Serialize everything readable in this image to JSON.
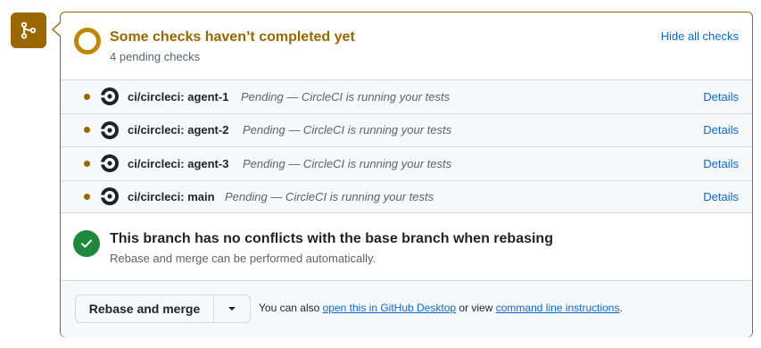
{
  "checks_summary": {
    "title": "Some checks haven’t completed yet",
    "subtitle": "4 pending checks",
    "hide_label": "Hide all checks"
  },
  "checks": [
    {
      "name": "ci/circleci: agent-1",
      "description": "Pending — CircleCI is running your tests",
      "details_label": "Details"
    },
    {
      "name": "ci/circleci: agent-2",
      "description": "Pending — CircleCI is running your tests",
      "details_label": "Details"
    },
    {
      "name": "ci/circleci: agent-3",
      "description": "Pending — CircleCI is running your tests",
      "details_label": "Details"
    },
    {
      "name": "ci/circleci: main",
      "description": "Pending — CircleCI is running your tests",
      "details_label": "Details"
    }
  ],
  "conflicts": {
    "title": "This branch has no conflicts with the base branch when rebasing",
    "subtitle": "Rebase and merge can be performed automatically."
  },
  "merge": {
    "button_label": "Rebase and merge",
    "text_prefix": "You can also",
    "desktop_link": "open this in GitHub Desktop",
    "text_middle": "or view",
    "cli_link": "command line instructions",
    "text_suffix": "."
  },
  "icons": {
    "merge_badge": "git-merge-icon",
    "pending": "pending-ring-icon",
    "ci": "circleci-icon",
    "success": "check-circle-icon",
    "dropdown": "triangle-down-icon"
  },
  "colors": {
    "attention": "#9a6700",
    "success": "#1f883d",
    "link": "#0969da"
  }
}
